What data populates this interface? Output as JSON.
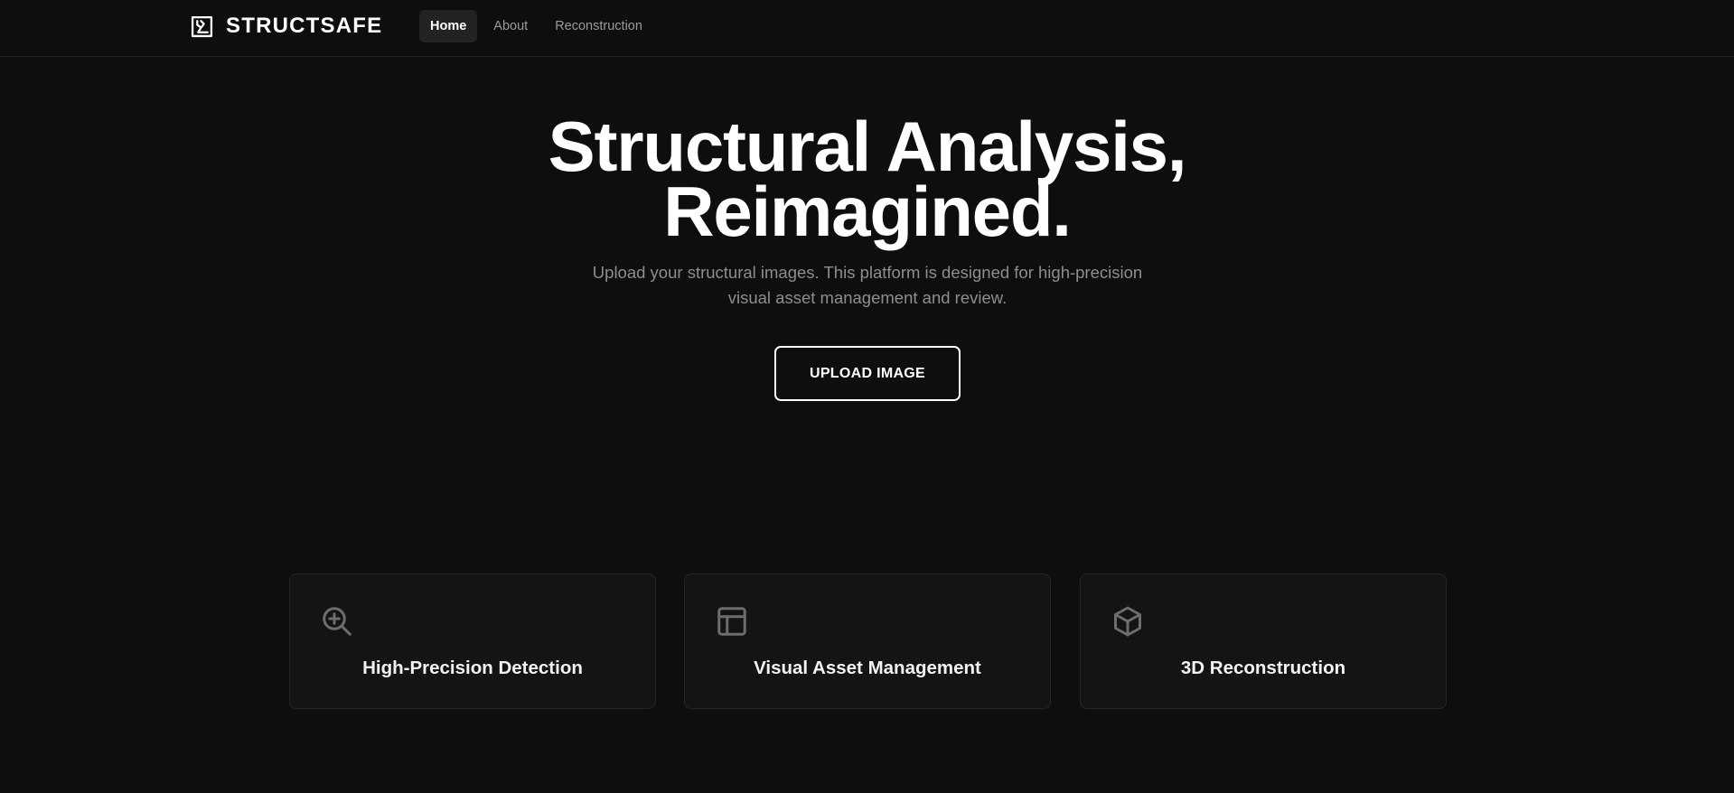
{
  "brand": {
    "name": "STRUCTSAFE",
    "icon": "structsafe-logo-icon"
  },
  "nav": {
    "items": [
      {
        "label": "Home",
        "active": true
      },
      {
        "label": "About",
        "active": false
      },
      {
        "label": "Reconstruction",
        "active": false
      }
    ]
  },
  "hero": {
    "title_line1": "Structural Analysis,",
    "title_line2": "Reimagined.",
    "subtitle_line1": "Upload your structural images. This platform is designed for high-precision",
    "subtitle_line2": "visual asset management and review.",
    "upload_label": "UPLOAD IMAGE"
  },
  "features": [
    {
      "title": "High-Precision Detection",
      "icon": "zoom-in-icon"
    },
    {
      "title": "Visual Asset Management",
      "icon": "layout-icon"
    },
    {
      "title": "3D Reconstruction",
      "icon": "cube-icon"
    }
  ],
  "colors": {
    "background": "#0e0e0e",
    "card_background": "#141414",
    "text_primary": "#ffffff",
    "text_muted": "#8e8e8e",
    "icon_gray": "#6d6d6d",
    "nav_active_bg": "#222222"
  }
}
